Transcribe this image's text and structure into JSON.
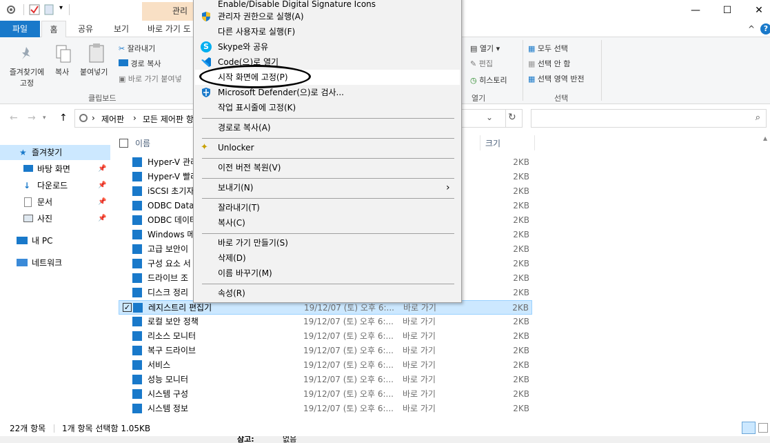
{
  "titlebar": {
    "manage_tab": "관리",
    "minimize": "—",
    "maximize": "☐",
    "close": "✕"
  },
  "tabs": {
    "file": "파일",
    "home": "홈",
    "share": "공유",
    "view": "보기",
    "manage_sub": "바로 가기 도",
    "collapse": "^",
    "help": "?"
  },
  "ribbon": {
    "pin": "즐겨찾기에\n고정",
    "pin_line1": "즐겨찾기에",
    "pin_line2": "고정",
    "copy": "복사",
    "paste": "붙여넣기",
    "cut": "잘라내기",
    "copy_path": "경로 복사",
    "paste_shortcut": "바로 가기 붙여넣",
    "clipboard_group": "클립보드",
    "open": "열기",
    "edit": "편집",
    "history": "히스토리",
    "open_group": "열기",
    "select_all": "모두 선택",
    "select_none": "선택 안 함",
    "invert_selection": "선택 영역 반전",
    "select_group": "선택"
  },
  "address": {
    "crumb1": "제어판",
    "crumb2": "모든 제어판 항",
    "sep": "›"
  },
  "nav": {
    "quick_access": "즐겨찾기",
    "desktop": "바탕 화면",
    "downloads": "다운로드",
    "documents": "문서",
    "pictures": "사진",
    "this_pc": "내 PC",
    "network": "네트워크"
  },
  "columns": {
    "name": "이름",
    "size": "크기"
  },
  "files": [
    {
      "name": "Hyper-V 관리",
      "date": "",
      "type": "",
      "size": "2KB"
    },
    {
      "name": "Hyper-V 빨리",
      "date": "",
      "type": "",
      "size": "2KB"
    },
    {
      "name": "iSCSI 초기자",
      "date": "",
      "type": "",
      "size": "2KB"
    },
    {
      "name": "ODBC Data",
      "date": "",
      "type": "",
      "size": "2KB"
    },
    {
      "name": "ODBC 데이터",
      "date": "",
      "type": "",
      "size": "2KB"
    },
    {
      "name": "Windows 메",
      "date": "",
      "type": "",
      "size": "2KB"
    },
    {
      "name": "고급 보안이",
      "date": "",
      "type": "",
      "size": "2KB"
    },
    {
      "name": "구성 요소 서",
      "date": "",
      "type": "",
      "size": "2KB"
    },
    {
      "name": "드라이브 조",
      "date": "",
      "type": "",
      "size": "2KB"
    },
    {
      "name": "디스크 정리",
      "date": "",
      "type": "",
      "size": "2KB"
    },
    {
      "name": "레지스트리 편집기",
      "date": "19/12/07 (토) 오후 6:...",
      "type": "바로 가기",
      "size": "2KB"
    },
    {
      "name": "로컬 보안 정책",
      "date": "19/12/07 (토) 오후 6:...",
      "type": "바로 가기",
      "size": "2KB"
    },
    {
      "name": "리소스 모니터",
      "date": "19/12/07 (토) 오후 6:...",
      "type": "바로 가기",
      "size": "2KB"
    },
    {
      "name": "복구 드라이브",
      "date": "19/12/07 (토) 오후 6:...",
      "type": "바로 가기",
      "size": "2KB"
    },
    {
      "name": "서비스",
      "date": "19/12/07 (토) 오후 6:...",
      "type": "바로 가기",
      "size": "2KB"
    },
    {
      "name": "성능 모니터",
      "date": "19/12/07 (토) 오후 6:...",
      "type": "바로 가기",
      "size": "2KB"
    },
    {
      "name": "시스템 구성",
      "date": "19/12/07 (토) 오후 6:...",
      "type": "바로 가기",
      "size": "2KB"
    },
    {
      "name": "시스템 정보",
      "date": "19/12/07 (토) 오후 6:...",
      "type": "바로 가기",
      "size": "2KB"
    }
  ],
  "status": {
    "count": "22개 항목",
    "selected": "1개 항목 선택함 1.05KB"
  },
  "context_menu": {
    "digital_sig": "Enable/Disable Digital Signature Icons",
    "run_admin": "관리자 권한으로 실행(A)",
    "run_other": "다른 사용자로 실행(F)",
    "skype": "Skype와 공유",
    "code": "Code(으)로 열기",
    "pin_start": "시작 화면에 고정(P)",
    "defender": "Microsoft Defender(으)로 검사...",
    "pin_taskbar": "작업 표시줄에 고정(K)",
    "copy_path": "경로로 복사(A)",
    "unlocker": "Unlocker",
    "restore": "이전 버전 복원(V)",
    "send_to": "보내기(N)",
    "cut": "잘라내기(T)",
    "copy": "복사(C)",
    "shortcut": "바로 가기 만들기(S)",
    "delete": "삭제(D)",
    "rename": "이름 바꾸기(M)",
    "properties": "속성(R)"
  },
  "bottom": {
    "text1": "삼고:",
    "text2": "없음"
  },
  "colors": {
    "accent": "#1979ca",
    "selection": "#cce8ff",
    "manage_tab": "#f9e0c5"
  }
}
